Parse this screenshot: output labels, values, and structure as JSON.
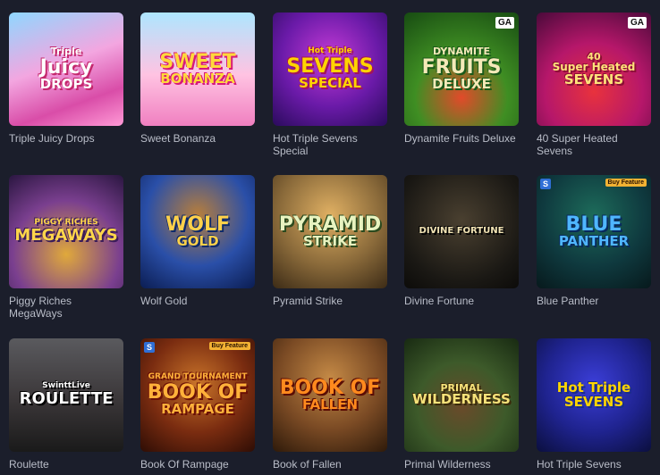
{
  "games": [
    {
      "name": "Triple Juicy Drops",
      "logo": [
        "Triple",
        "Juicy",
        "DROPS"
      ],
      "badge": "",
      "buy": "",
      "left_badge": "",
      "logo_color": "#ffffff",
      "logo_shadow": "#c4286d",
      "art": "linear-gradient(160deg,#8fd7ff 0%,#f3a6e0 45%,#d94da8 75%,#ff9ad6 100%)"
    },
    {
      "name": "Sweet Bonanza",
      "logo": [
        "",
        "SWEET",
        "BONANZA"
      ],
      "badge": "",
      "buy": "",
      "left_badge": "",
      "logo_color": "#ffd83b",
      "logo_shadow": "#d6197a",
      "art": "linear-gradient(180deg,#aee6ff 0%,#ffc3e2 55%,#f07fc0 100%)"
    },
    {
      "name": "Hot Triple Sevens Special",
      "logo": [
        "Hot Triple",
        "SEVENS",
        "SPECIAL"
      ],
      "badge": "",
      "buy": "",
      "left_badge": "",
      "logo_color": "#ffd400",
      "logo_shadow": "#a1145c",
      "art": "radial-gradient(circle at 50% 40%,#c43bd6 0%,#6a1aa8 55%,#2a0b5c 100%)"
    },
    {
      "name": "Dynamite Fruits Deluxe",
      "logo": [
        "DYNAMITE",
        "FRUITS",
        "DELUXE"
      ],
      "badge": "GA",
      "buy": "",
      "left_badge": "",
      "logo_color": "#f5e9b8",
      "logo_shadow": "#1a5a1a",
      "art": "radial-gradient(circle at 50% 75%,#e24a2a 0%,#3f8e23 45%,#174b12 100%)"
    },
    {
      "name": "40 Super Heated Sevens",
      "logo": [
        "40",
        "Super Heated",
        "SEVENS"
      ],
      "badge": "GA",
      "buy": "",
      "left_badge": "",
      "logo_color": "#ffe27a",
      "logo_shadow": "#8a0f34",
      "art": "radial-gradient(circle at 50% 70%,#e8323d 0%,#b6176a 50%,#4a0a3a 100%)"
    },
    {
      "name": "Piggy Riches MegaWays",
      "logo": [
        "PIGGY RICHES",
        "MEGAWAYS",
        ""
      ],
      "badge": "",
      "buy": "",
      "left_badge": "",
      "logo_color": "#ffd64a",
      "logo_shadow": "#3b1c5a",
      "art": "radial-gradient(circle at 50% 70%,#e0a93b 0%,#7a3f8f 55%,#2a1640 100%)"
    },
    {
      "name": "Wolf Gold",
      "logo": [
        "",
        "WOLF",
        "GOLD"
      ],
      "badge": "",
      "buy": "",
      "left_badge": "",
      "logo_color": "#ffd14a",
      "logo_shadow": "#0e2a6b",
      "art": "radial-gradient(circle at 50% 35%,#b77e3c 0%,#2a4fa8 55%,#0b1d52 100%)"
    },
    {
      "name": "Pyramid Strike",
      "logo": [
        "",
        "PYRAMID",
        "STRIKE"
      ],
      "badge": "",
      "buy": "",
      "left_badge": "",
      "logo_color": "#e8f3c0",
      "logo_shadow": "#2b4a1e",
      "art": "radial-gradient(circle at 50% 35%,#e0b063 0%,#8a6a3a 55%,#3c2b16 100%)"
    },
    {
      "name": "Divine Fortune",
      "logo": [
        "",
        "",
        "DIVINE FORTUNE"
      ],
      "badge": "",
      "buy": "",
      "left_badge": "",
      "logo_color": "#f1e3b4",
      "logo_shadow": "#000000",
      "art": "radial-gradient(circle at 50% 40%,#4a4030 0%,#1a1814 70%,#0c0b09 100%)"
    },
    {
      "name": "Blue Panther",
      "logo": [
        "",
        "BLUE",
        "PANTHER"
      ],
      "badge": "",
      "buy": "Buy Feature",
      "left_badge": "S",
      "logo_color": "#4fb6ff",
      "logo_shadow": "#082a5c",
      "art": "radial-gradient(circle at 50% 35%,#1d6b5a 0%,#0f3a3f 55%,#07191c 100%)"
    },
    {
      "name": "Roulette",
      "logo": [
        "SwinttLive",
        "ROULETTE",
        ""
      ],
      "badge": "",
      "buy": "",
      "left_badge": "",
      "logo_color": "#ffffff",
      "logo_shadow": "#000000",
      "art": "linear-gradient(180deg,#5a5a5e 0%,#3a3638 55%,#1a1a1a 100%)"
    },
    {
      "name": "Book Of Rampage",
      "logo": [
        "GRAND TOURNAMENT",
        "BOOK OF",
        "RAMPAGE"
      ],
      "badge": "",
      "buy": "Buy Feature",
      "left_badge": "S",
      "logo_color": "#ffb13a",
      "logo_shadow": "#6a1006",
      "art": "radial-gradient(circle at 50% 40%,#c9742a 0%,#7a2c10 55%,#2e0d05 100%)"
    },
    {
      "name": "Book of Fallen",
      "logo": [
        "",
        "BOOK OF",
        "FALLEN"
      ],
      "badge": "",
      "buy": "",
      "left_badge": "",
      "logo_color": "#ff8a1e",
      "logo_shadow": "#5a0d05",
      "art": "radial-gradient(circle at 50% 35%,#c58a46 0%,#7a4a24 55%,#2e1a0a 100%)"
    },
    {
      "name": "Primal Wilderness",
      "logo": [
        "PRIMAL",
        "WILDERNESS",
        ""
      ],
      "badge": "",
      "buy": "",
      "left_badge": "",
      "logo_color": "#f6e27a",
      "logo_shadow": "#3a2a0a",
      "art": "radial-gradient(circle at 50% 60%,#6a4a2a 0%,#3d5a2a 50%,#182a12 100%)"
    },
    {
      "name": "Hot Triple Sevens",
      "logo": [
        "",
        "Hot Triple",
        "SEVENS"
      ],
      "badge": "",
      "buy": "",
      "left_badge": "",
      "logo_color": "#ffd400",
      "logo_shadow": "#1a2c8a",
      "art": "radial-gradient(circle at 50% 40%,#3b3ed8 0%,#1f238f 55%,#0b0f3e 100%)"
    }
  ]
}
